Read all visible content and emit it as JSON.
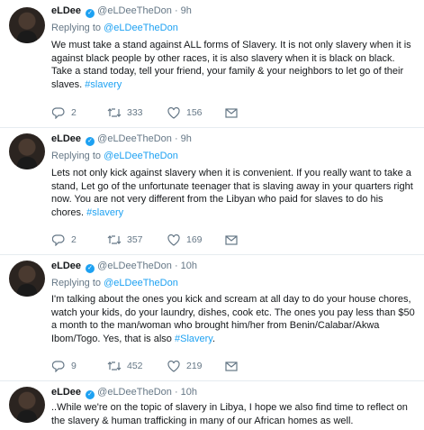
{
  "user": {
    "name": "eLDee",
    "handle": "@eLDeeTheDon",
    "dot": "·"
  },
  "replying": {
    "prefix": "Replying to",
    "target": "@eLDeeTheDon"
  },
  "tweets": [
    {
      "time": "9h",
      "text": "We must take a stand against ALL forms of Slavery. It is not only slavery when it is against black people by other races, it is also slavery when it is black on black. Take a stand today, tell your friend, your family & your neighbors to let go of their slaves. ",
      "hashtag": "#slavery",
      "replies": "2",
      "retweets": "333",
      "likes": "156"
    },
    {
      "time": "9h",
      "text": "Lets not only kick against slavery when it is convenient. If you really want to take a stand, Let go of the unfortunate teenager that is slaving away in your quarters right now. You are not very different from the Libyan who paid for slaves to do his chores. ",
      "hashtag": "#slavery",
      "replies": "2",
      "retweets": "357",
      "likes": "169"
    },
    {
      "time": "10h",
      "text": "I'm talking about the ones you kick and scream at all day to do your house chores, watch your kids, do your laundry, dishes, cook etc. The ones you pay less than $50 a month to the man/woman who brought him/her from Benin/Calabar/Akwa Ibom/Togo. Yes, that is also ",
      "hashtag": "#Slavery",
      "hashtag_suffix": ".",
      "replies": "9",
      "retweets": "452",
      "likes": "219"
    },
    {
      "time": "10h",
      "text": "..While we're on the topic of slavery in Libya, I hope we also find time to reflect on the slavery & human trafficking in many of our African homes as well."
    }
  ],
  "colors": {
    "accent": "#1da1f2",
    "muted": "#657786",
    "text": "#14171a",
    "divider": "#e6ecf0"
  },
  "icons": [
    "verified-badge-icon",
    "reply-icon",
    "retweet-icon",
    "like-icon",
    "message-icon"
  ]
}
